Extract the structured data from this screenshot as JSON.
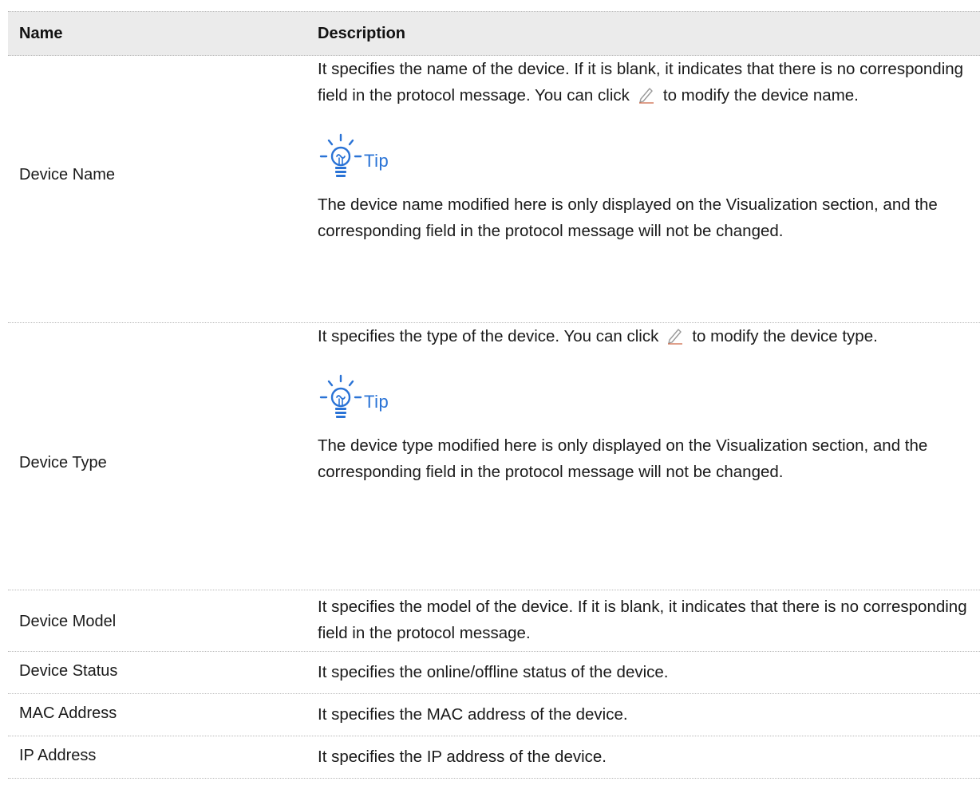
{
  "table": {
    "headers": {
      "name": "Name",
      "description": "Description"
    },
    "rows": [
      {
        "name": "Device Name",
        "desc_before_icon": "It specifies the name of the device. If it is blank, it indicates that there is no corresponding field in the protocol message. You can click",
        "desc_after_icon": "to modify the device name.",
        "tip_label": "Tip",
        "tip_text": "The device name modified here is only displayed on the Visualization section, and the corresponding field in the protocol message will not be changed."
      },
      {
        "name": "Device Type",
        "desc_before_icon": "It specifies the type of the device. You can click",
        "desc_after_icon": "to modify the device type.",
        "tip_label": "Tip",
        "tip_text": "The device type modified here is only displayed on the Visualization section, and the corresponding field in the protocol message will not be changed."
      },
      {
        "name": "Device Model",
        "desc": "It specifies the model of the device. If it is blank, it indicates that there is no corresponding field in the protocol message."
      },
      {
        "name": "Device Status",
        "desc": "It specifies the online/offline status of the device."
      },
      {
        "name": "MAC Address",
        "desc": "It specifies the MAC address of the device."
      },
      {
        "name": "IP Address",
        "desc": "It specifies the IP address of the device."
      }
    ]
  },
  "icons": {
    "edit": "pencil-icon",
    "tip": "lightbulb-icon"
  },
  "colors": {
    "tip_accent": "#2a73d6",
    "header_bg": "#ebebeb",
    "pencil": "#a0a0a0"
  }
}
